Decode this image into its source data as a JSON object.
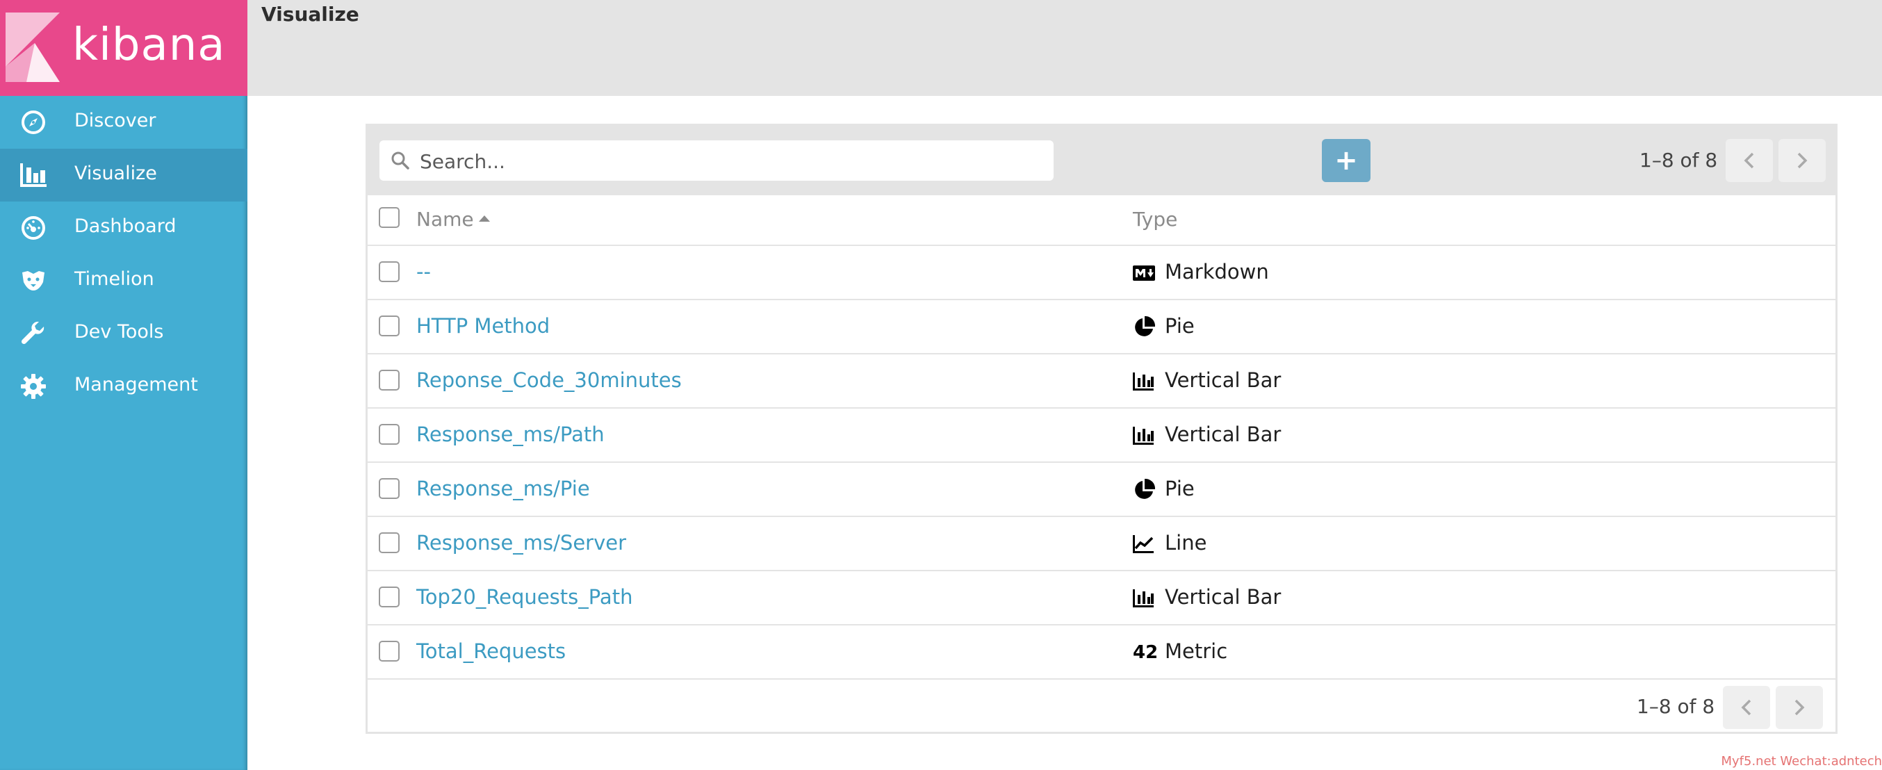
{
  "app": {
    "logo_text": "kibana",
    "page_title": "Visualize",
    "colors": {
      "sidebar": "#43aed3",
      "sidebar_active": "#3a99bf",
      "logo_bg": "#e8488b",
      "link": "#3c9bc2",
      "add_button": "#6eaac8"
    }
  },
  "sidebar": {
    "items": [
      {
        "label": "Discover",
        "icon": "compass-icon",
        "active": false
      },
      {
        "label": "Visualize",
        "icon": "bar-chart-icon",
        "active": true
      },
      {
        "label": "Dashboard",
        "icon": "dashboard-gauge-icon",
        "active": false
      },
      {
        "label": "Timelion",
        "icon": "timelion-icon",
        "active": false
      },
      {
        "label": "Dev Tools",
        "icon": "wrench-icon",
        "active": false
      },
      {
        "label": "Management",
        "icon": "gear-icon",
        "active": false
      }
    ]
  },
  "toolbar": {
    "search_placeholder": "Search...",
    "add_label": "+",
    "pager": "1–8 of 8"
  },
  "table": {
    "columns": {
      "name": "Name",
      "type": "Type"
    },
    "sort": {
      "column": "Name",
      "direction": "ascending"
    },
    "rows": [
      {
        "name": "--",
        "type": "Markdown",
        "icon": "markdown-icon"
      },
      {
        "name": "HTTP Method",
        "type": "Pie",
        "icon": "pie-chart-icon"
      },
      {
        "name": "Reponse_Code_30minutes",
        "type": "Vertical Bar",
        "icon": "bar-chart-icon"
      },
      {
        "name": "Response_ms/Path",
        "type": "Vertical Bar",
        "icon": "bar-chart-icon"
      },
      {
        "name": "Response_ms/Pie",
        "type": "Pie",
        "icon": "pie-chart-icon"
      },
      {
        "name": "Response_ms/Server",
        "type": "Line",
        "icon": "line-chart-icon"
      },
      {
        "name": "Top20_Requests_Path",
        "type": "Vertical Bar",
        "icon": "bar-chart-icon"
      },
      {
        "name": "Total_Requests",
        "type": "Metric",
        "icon": "metric-icon",
        "icon_text": "42"
      }
    ]
  },
  "footer": {
    "pager": "1–8 of 8"
  },
  "watermark": "Myf5.net Wechat:adntech"
}
